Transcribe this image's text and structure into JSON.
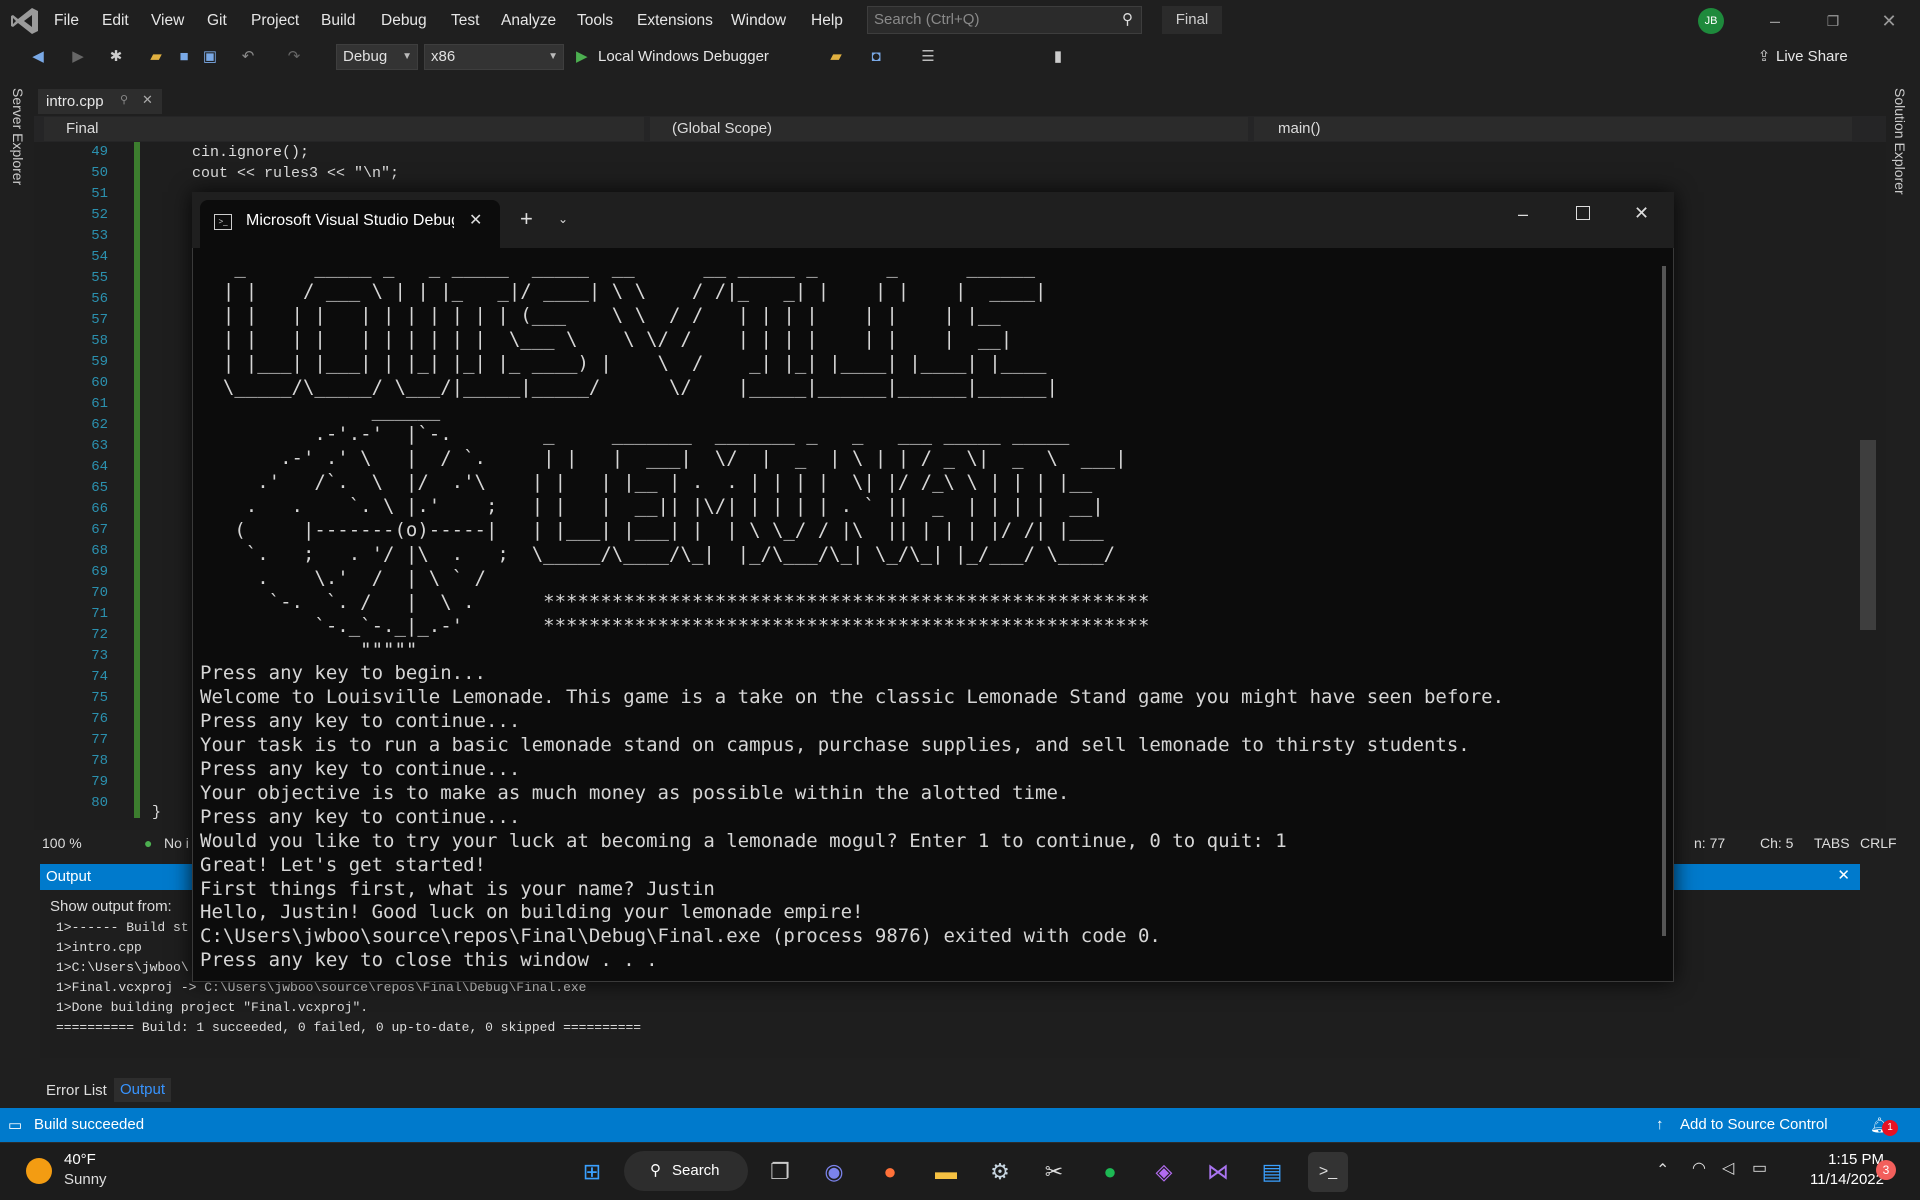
{
  "menu": [
    "File",
    "Edit",
    "View",
    "Git",
    "Project",
    "Build",
    "Debug",
    "Test",
    "Analyze",
    "Tools",
    "Extensions",
    "Window",
    "Help"
  ],
  "search": {
    "placeholder": "Search (Ctrl+Q)"
  },
  "solution_name": "Final",
  "avatar": "JB",
  "toolbar": {
    "config": "Debug",
    "platform": "x86",
    "debugger": "Local Windows Debugger",
    "live_share": "Live Share"
  },
  "side": {
    "left": "Server Explorer",
    "right": "Solution Explorer"
  },
  "editor": {
    "tab": "intro.cpp",
    "nav": {
      "project": "Final",
      "scope": "(Global Scope)",
      "member": "main()"
    },
    "line_numbers": [
      "49",
      "50",
      "51",
      "52",
      "53",
      "54",
      "55",
      "56",
      "57",
      "58",
      "59",
      "60",
      "61",
      "62",
      "63",
      "64",
      "65",
      "66",
      "67",
      "68",
      "69",
      "70",
      "71",
      "72",
      "73",
      "74",
      "75",
      "76",
      "77",
      "78",
      "79",
      "80"
    ],
    "line49": "cin.ignore();",
    "line50": "cout << rules3 << \"\\n\";",
    "line80": "}",
    "zoom": "100 %",
    "issues": "No i",
    "ln": "n: 77",
    "ch": "Ch: 5",
    "tabs": "TABS",
    "eol": "CRLF"
  },
  "output": {
    "title": "Output",
    "show_from": "Show output from:",
    "lines": [
      "1>------ Build st",
      "1>intro.cpp",
      "1>C:\\Users\\jwboo\\",
      "1>Final.vcxproj -> C:\\Users\\jwboo\\source\\repos\\Final\\Debug\\Final.exe",
      "1>Done building project \"Final.vcxproj\".",
      "========== Build: 1 succeeded, 0 failed, 0 up-to-date, 0 skipped =========="
    ],
    "tab_error": "Error List",
    "tab_output": "Output"
  },
  "status": {
    "left": "Build succeeded",
    "right": "Add to Source Control",
    "notifications": "1"
  },
  "console": {
    "title": "Microsoft Visual Studio Debug Console",
    "text": "   _      _____ _   _ _____  _____  __      __ _____ _      _      ______\n  | |    / ___ \\ | | |_   _|/ ____| \\ \\    / /|_   _| |    | |    |  ____|\n  | |   | |   | | | | | | | (___    \\ \\  / /   | | | |    | |    | |__\n  | |   | |   | | | | | |  \\___ \\    \\ \\/ /    | | | |    | |    |  __|\n  | |___| |___| | |_| |_| |_ ____) |    \\  /    _| |_| |____| |____| |____\n  \\_____/\\_____/ \\___/|_____|_____/      \\/    |_____|______|______|______|\n               ______\n          .-'.-'  |`-.        _     _______  _______ _   _   ___ _____ _____\n       .-' .' \\   |  / `.     | |   |  ___|  \\/  |  _  | \\ | | / _ \\|  _  \\  ___|\n     .'   /`.  \\  |/  .'\\    | |   | |__ | .  . | | | |  \\| |/ /_\\ \\ | | | |__\n    .   .    `. \\ |.'    ;   | |   |  __|| |\\/| | | | | . ` ||  _  | | | |  __|\n   (     |-------(o)-----|   | |___| |___| |  | \\ \\_/ / |\\  || | | | |/ /| |___\n    `.   ;   . '/ |\\  .   ;  \\_____/\\____/\\_|  |_/\\___/\\_| \\_/\\_| |_/___/ \\____/\n     .    \\.'  /  | \\ ` /\n      `-.  `. /   |  \\ .      *****************************************************\n          `-._`-._|_.-'       *****************************************************\n              \"\"\"\"\"\nPress any key to begin...\nWelcome to Louisville Lemonade. This game is a take on the classic Lemonade Stand game you might have seen before.\nPress any key to continue...\nYour task is to run a basic lemonade stand on campus, purchase supplies, and sell lemonade to thirsty students.\nPress any key to continue...\nYour objective is to make as much money as possible within the alotted time.\nPress any key to continue...\nWould you like to try your luck at becoming a lemonade mogul? Enter 1 to continue, 0 to quit: 1\nGreat! Let's get started!\nFirst things first, what is your name? Justin\nHello, Justin! Good luck on building your lemonade empire!\nC:\\Users\\jwboo\\source\\repos\\Final\\Debug\\Final.exe (process 9876) exited with code 0.\nPress any key to close this window . . ."
  },
  "taskbar": {
    "temp": "40°F",
    "weather": "Sunny",
    "search": "Search",
    "time": "1:15 PM",
    "date": "11/14/2022",
    "badge": "3"
  }
}
